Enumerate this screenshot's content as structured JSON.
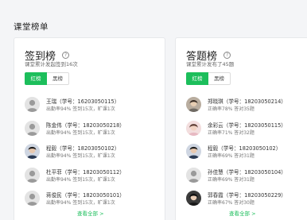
{
  "page": {
    "title": "课堂榜单"
  },
  "checkin_board": {
    "title": "签到榜",
    "subtitle": "课堂累计发起签到16次",
    "tabs": [
      {
        "label": "红榜",
        "active": true
      },
      {
        "label": "黑榜",
        "active": false
      }
    ],
    "entries": [
      {
        "name": "王瑞（学号：16203050115）",
        "stats": "出勤率94%  签到15次，旷课1次",
        "avatar": "gray-silhouette"
      },
      {
        "name": "陈金伟（学号：18203050218）",
        "stats": "出勤率94%  签到15次，旷课1次",
        "avatar": "gray-silhouette"
      },
      {
        "name": "程毅（学号：18203050102）",
        "stats": "出勤率94%  签到15次，旷课1次",
        "avatar": "dark-hair"
      },
      {
        "name": "杜平菲（学号：18203050112）",
        "stats": "出勤率94%  签到15次，旷课1次",
        "avatar": "gray-silhouette"
      },
      {
        "name": "蒋俊民（学号：18203050101）",
        "stats": "出勤率94%  签到15次，旷课1次",
        "avatar": "gray-silhouette"
      }
    ],
    "more_label": "查看全部 >"
  },
  "answer_board": {
    "title": "答题榜",
    "subtitle": "课堂累计发布了45题",
    "tabs": [
      {
        "label": "红榜",
        "active": true
      },
      {
        "label": "黑榜",
        "active": false
      }
    ],
    "entries": [
      {
        "name": "郑晓琪（学号：18203050214）",
        "stats": "正确率78%  答对35题",
        "avatar": "photo-tan"
      },
      {
        "name": "余彩云（学号：18203050115）",
        "stats": "正确率71%  答对32题",
        "avatar": "photo-pink"
      },
      {
        "name": "程毅（学号：18203050102）",
        "stats": "正确率69%  答对31题",
        "avatar": "dark-hair"
      },
      {
        "name": "孙佳慧（学号：18203050104）",
        "stats": "正确率69%  答对31题",
        "avatar": "gray-silhouette"
      },
      {
        "name": "郭春霞（学号：18203050229）",
        "stats": "正确率67%  答对30题",
        "avatar": "photo-dark"
      }
    ],
    "more_label": "查看全部 >"
  },
  "colors": {
    "accent": "#1cbe5b",
    "background": "#f4f5f7",
    "card": "#ffffff"
  }
}
